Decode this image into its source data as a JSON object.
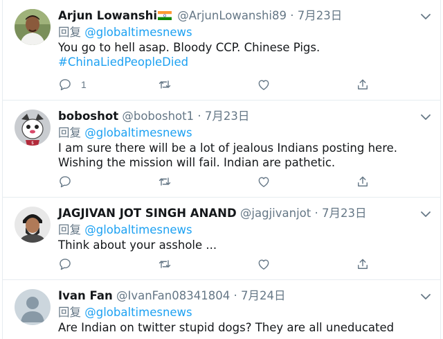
{
  "tweets": [
    {
      "display_name": "Arjun Lowanshi",
      "flag": "india-flag",
      "handle": "@ArjunLowanshi89",
      "separator": "·",
      "date": "7月23日",
      "reply_prefix": "回复",
      "reply_to": "@globaltimesnews",
      "text": "You go to hell asap. Bloody CCP. Chinese Pigs.",
      "hashtag": "#ChinaLiedPeopleDied",
      "reply_count": "1",
      "retweet_count": "",
      "like_count": ""
    },
    {
      "display_name": "boboshot",
      "handle": "@boboshot1",
      "separator": "·",
      "date": "7月23日",
      "reply_prefix": "回复",
      "reply_to": "@globaltimesnews",
      "text": "I am sure there will be a lot of jealous Indians posting here. Wishing the mission will fail. Indian are pathetic.",
      "reply_count": "",
      "retweet_count": "",
      "like_count": ""
    },
    {
      "display_name": "JAGJIVAN JOT SINGH ANAND",
      "handle": "@jagjivanjot",
      "separator": "·",
      "date": "7月23日",
      "reply_prefix": "回复",
      "reply_to": "@globaltimesnews",
      "text": "Think about your asshole ...",
      "reply_count": "",
      "retweet_count": "",
      "like_count": ""
    },
    {
      "display_name": "Ivan Fan",
      "handle": "@IvanFan08341804",
      "separator": "·",
      "date": "7月24日",
      "reply_prefix": "回复",
      "reply_to": "@globaltimesnews",
      "text": "Are Indian on twitter stupid dogs? They are all uneducated arrogances."
    }
  ],
  "icons": {
    "reply": "reply-icon",
    "retweet": "retweet-icon",
    "like": "heart-icon",
    "share": "share-icon",
    "menu": "chevron-down-icon"
  },
  "colors": {
    "link": "#1da1f2",
    "secondary_text": "#657786",
    "primary_text": "#14171a",
    "divider": "#e6ecf0"
  }
}
